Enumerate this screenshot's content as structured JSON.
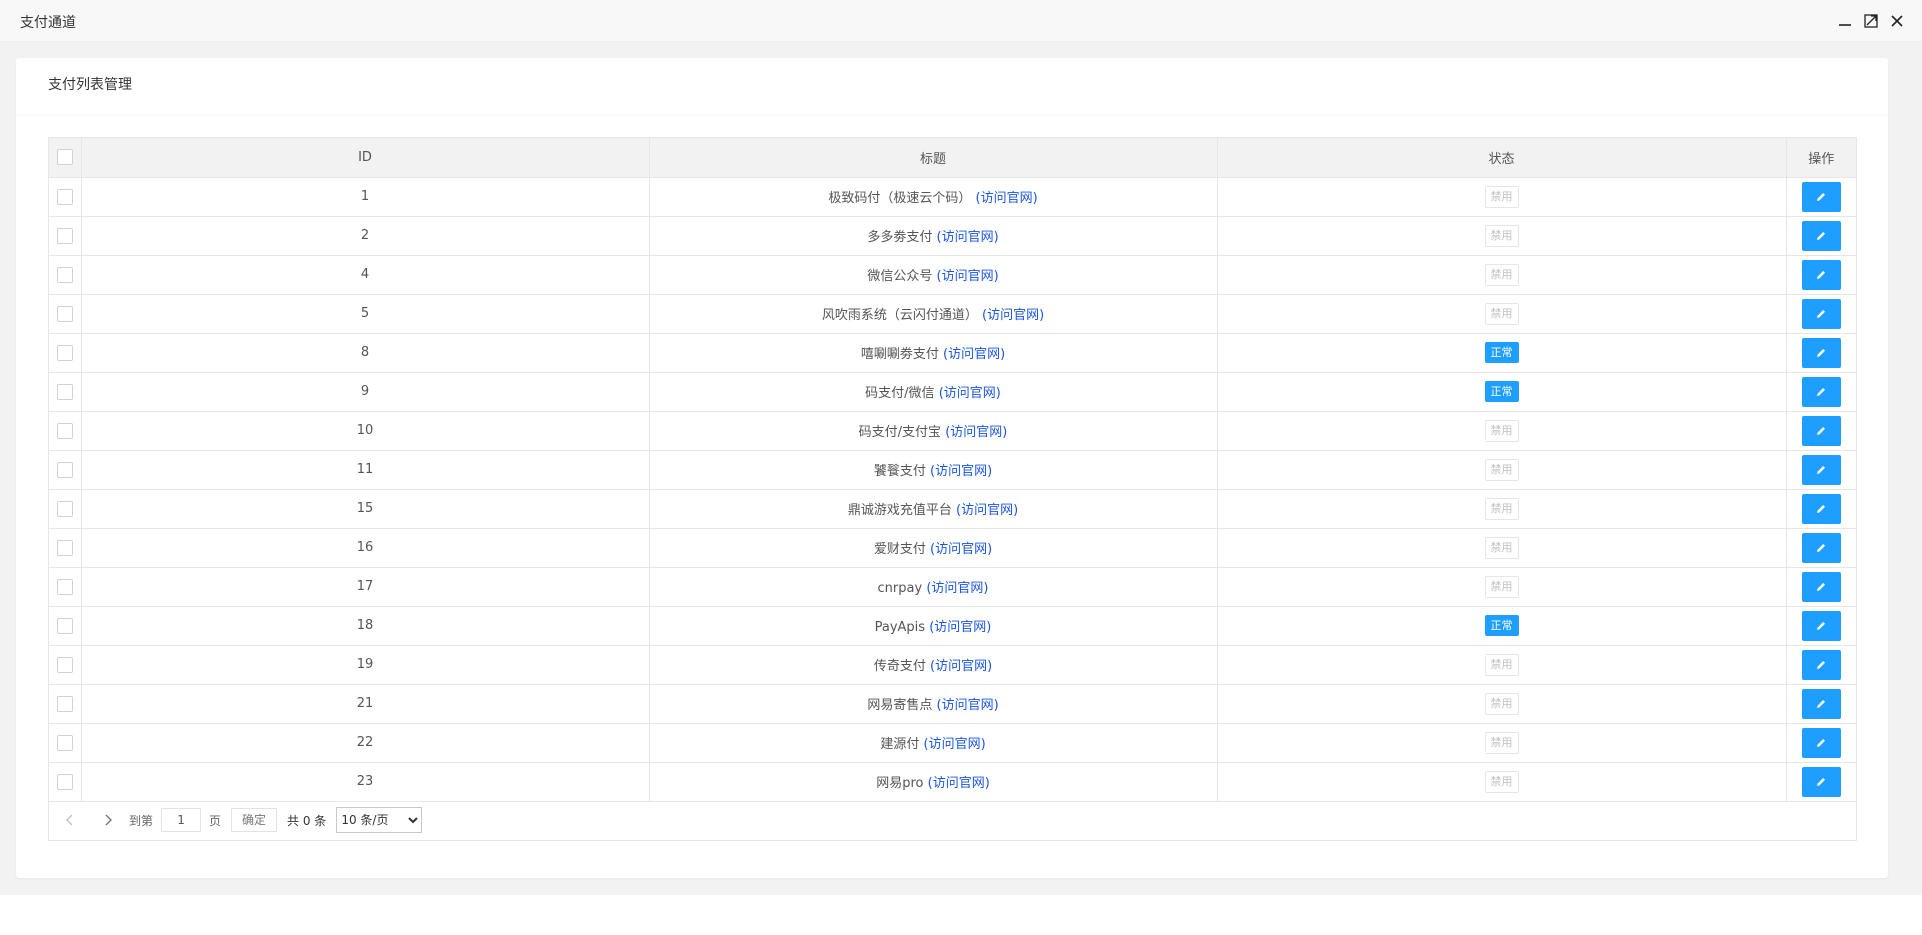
{
  "window": {
    "title": "支付通道"
  },
  "card": {
    "title": "支付列表管理"
  },
  "table": {
    "columns": [
      "ID",
      "标题",
      "状态",
      "操作"
    ],
    "visit_link_text": "(访问官网)",
    "rows": [
      {
        "id": "1",
        "title": "极致码付（极速云个码）",
        "status": "禁用"
      },
      {
        "id": "2",
        "title": "多多劵支付",
        "status": "禁用"
      },
      {
        "id": "4",
        "title": "微信公众号",
        "status": "禁用"
      },
      {
        "id": "5",
        "title": "风吹雨系统（云闪付通道）",
        "status": "禁用"
      },
      {
        "id": "8",
        "title": "嘻唰唰劵支付",
        "status": "正常"
      },
      {
        "id": "9",
        "title": "码支付/微信",
        "status": "正常"
      },
      {
        "id": "10",
        "title": "码支付/支付宝",
        "status": "禁用"
      },
      {
        "id": "11",
        "title": "饕餮支付",
        "status": "禁用"
      },
      {
        "id": "15",
        "title": "鼎诚游戏充值平台",
        "status": "禁用"
      },
      {
        "id": "16",
        "title": "爱财支付",
        "status": "禁用"
      },
      {
        "id": "17",
        "title": "cnrpay",
        "status": "禁用"
      },
      {
        "id": "18",
        "title": "PayApis",
        "status": "正常"
      },
      {
        "id": "19",
        "title": "传奇支付",
        "status": "禁用"
      },
      {
        "id": "21",
        "title": "网易寄售点",
        "status": "禁用"
      },
      {
        "id": "22",
        "title": "建源付",
        "status": "禁用"
      },
      {
        "id": "23",
        "title": "网易pro",
        "status": "禁用"
      }
    ]
  },
  "pager": {
    "goto_label": "到第",
    "page_value": "1",
    "page_unit": "页",
    "confirm_label": "确定",
    "total_text": "共 0 条",
    "page_size_selected": "10 条/页"
  },
  "colors": {
    "accent": "#1e9fff",
    "link": "#1a55e3"
  }
}
